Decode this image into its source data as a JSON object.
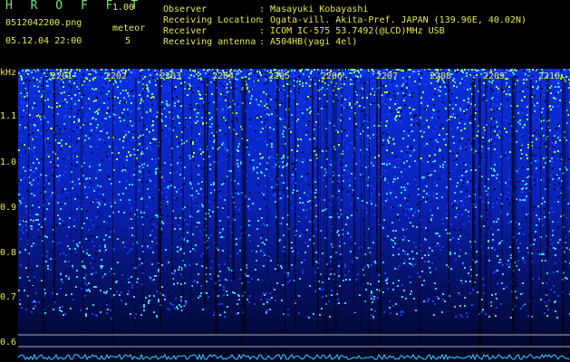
{
  "header": {
    "app_title": "H R O F F T",
    "version": "1.00",
    "filename": "0512042200.png",
    "datetime": "05.12.04 22:00",
    "meteor_label": "meteor",
    "meteor_count": "5"
  },
  "metadata": [
    {
      "label": "Observer",
      "value": ": Masayuki Kobayashi"
    },
    {
      "label": "Receiving Location",
      "value": ": Ogata-vill. Akita-Pref. JAPAN (139.96E, 40.02N)"
    },
    {
      "label": "Receiver",
      "value": ": ICOM IC-575 53.7492(@LCD)MHz USB"
    },
    {
      "label": "Receiving antenna",
      "value": ": A504HB(yagi 4el)"
    }
  ],
  "spectrogram": {
    "y_unit": "kHz",
    "y_ticks": [
      "1.1",
      "1.0",
      "0.9",
      "0.8",
      "0.7",
      "0.6"
    ],
    "x_ticks": [
      "2201",
      "2202",
      "2203",
      "2204",
      "2205",
      "2206",
      "2207",
      "2208",
      "2209",
      "2210"
    ],
    "colors": {
      "deep": "#000a40",
      "mid": "#1a3dff",
      "bright": "#2fd6ff",
      "hot": "#9dff4a",
      "label": "#e8e84a",
      "line": "#b0b0b0"
    }
  }
}
